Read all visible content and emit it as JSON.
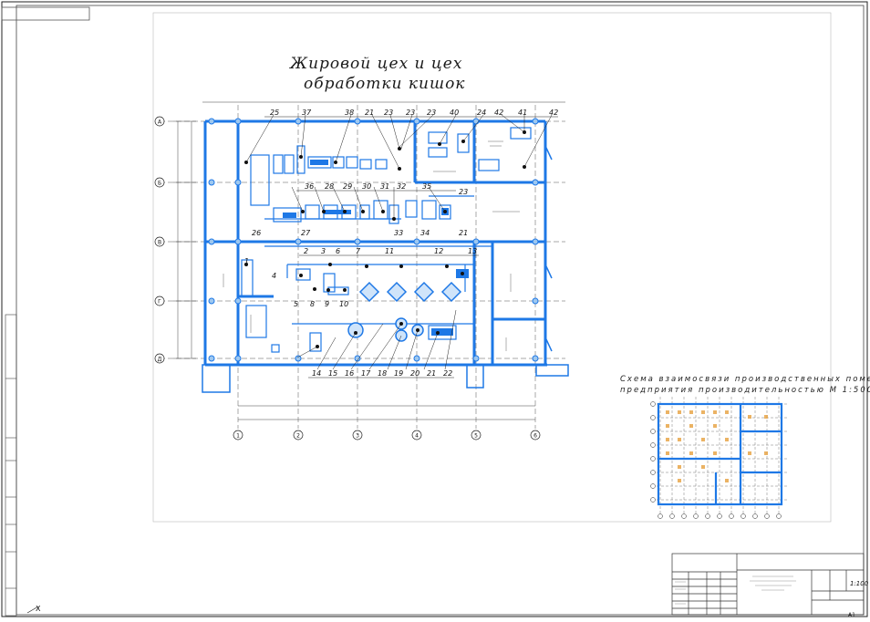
{
  "title_line1": "Жировой цех  и  цех",
  "title_line2": "обработки кишок",
  "scheme_line1": "Схема  взаимосвязи  производственных  помещений",
  "scheme_line2": "предприятия производительностью М 1:500",
  "axis_rows": [
    "А",
    "Б",
    "В",
    "Г",
    "Д"
  ],
  "axis_cols": [
    "1",
    "2",
    "3",
    "4",
    "5",
    "6"
  ],
  "top_callouts": [
    "25",
    "37",
    "38",
    "21",
    "23",
    "23",
    "23",
    "40",
    "24",
    "42",
    "41",
    "42"
  ],
  "mid_callouts": [
    "36",
    "27",
    "28",
    "29",
    "30",
    "31",
    "32",
    "33",
    "34",
    "35",
    "23",
    "21"
  ],
  "row_callouts": [
    "26",
    "3",
    "2",
    "6",
    "7",
    "11",
    "12",
    "13"
  ],
  "left_callouts": [
    "1",
    "4",
    "5",
    "8",
    "9",
    "10"
  ],
  "bottom_callouts": [
    "14",
    "15",
    "16",
    "17",
    "18",
    "19",
    "20",
    "21",
    "22"
  ],
  "scale": "1:100",
  "sheet_label": "A1",
  "axis_marker": "X"
}
